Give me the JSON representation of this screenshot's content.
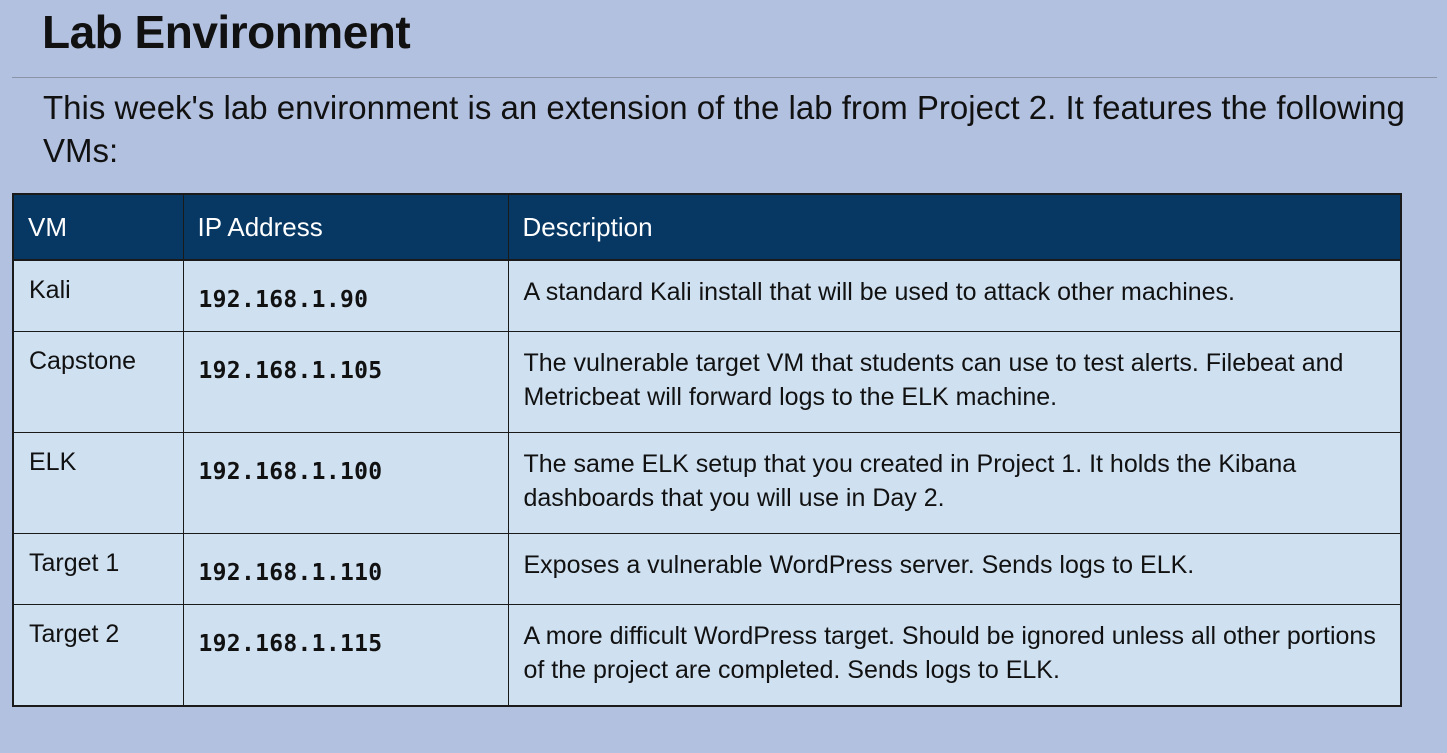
{
  "slide": {
    "title": "Lab Environment",
    "intro": "This week's lab environment is an extension of the lab from Project 2. It features the following VMs:"
  },
  "table": {
    "headers": {
      "vm": "VM",
      "ip": "IP Address",
      "description": "Description"
    },
    "rows": [
      {
        "vm": "Kali",
        "ip": "192.168.1.90",
        "description": "A standard Kali install that will be used to attack other machines."
      },
      {
        "vm": "Capstone",
        "ip": "192.168.1.105",
        "description": "The vulnerable target VM that students can use to test alerts. Filebeat and Metricbeat will forward logs to the ELK machine."
      },
      {
        "vm": "ELK",
        "ip": "192.168.1.100",
        "description": "The same ELK setup that you created in Project 1. It holds the Kibana dashboards that you will use in Day 2."
      },
      {
        "vm": "Target 1",
        "ip": "192.168.1.110",
        "description": "Exposes a vulnerable WordPress server. Sends logs to ELK."
      },
      {
        "vm": "Target 2",
        "ip": "192.168.1.115",
        "description": "A more difficult WordPress target. Should be ignored unless all other portions of the project are completed. Sends logs to ELK."
      }
    ]
  },
  "colors": {
    "background": "#b3c1e0",
    "header_fill": "#073763",
    "cell_fill": "#cfe0f1"
  }
}
